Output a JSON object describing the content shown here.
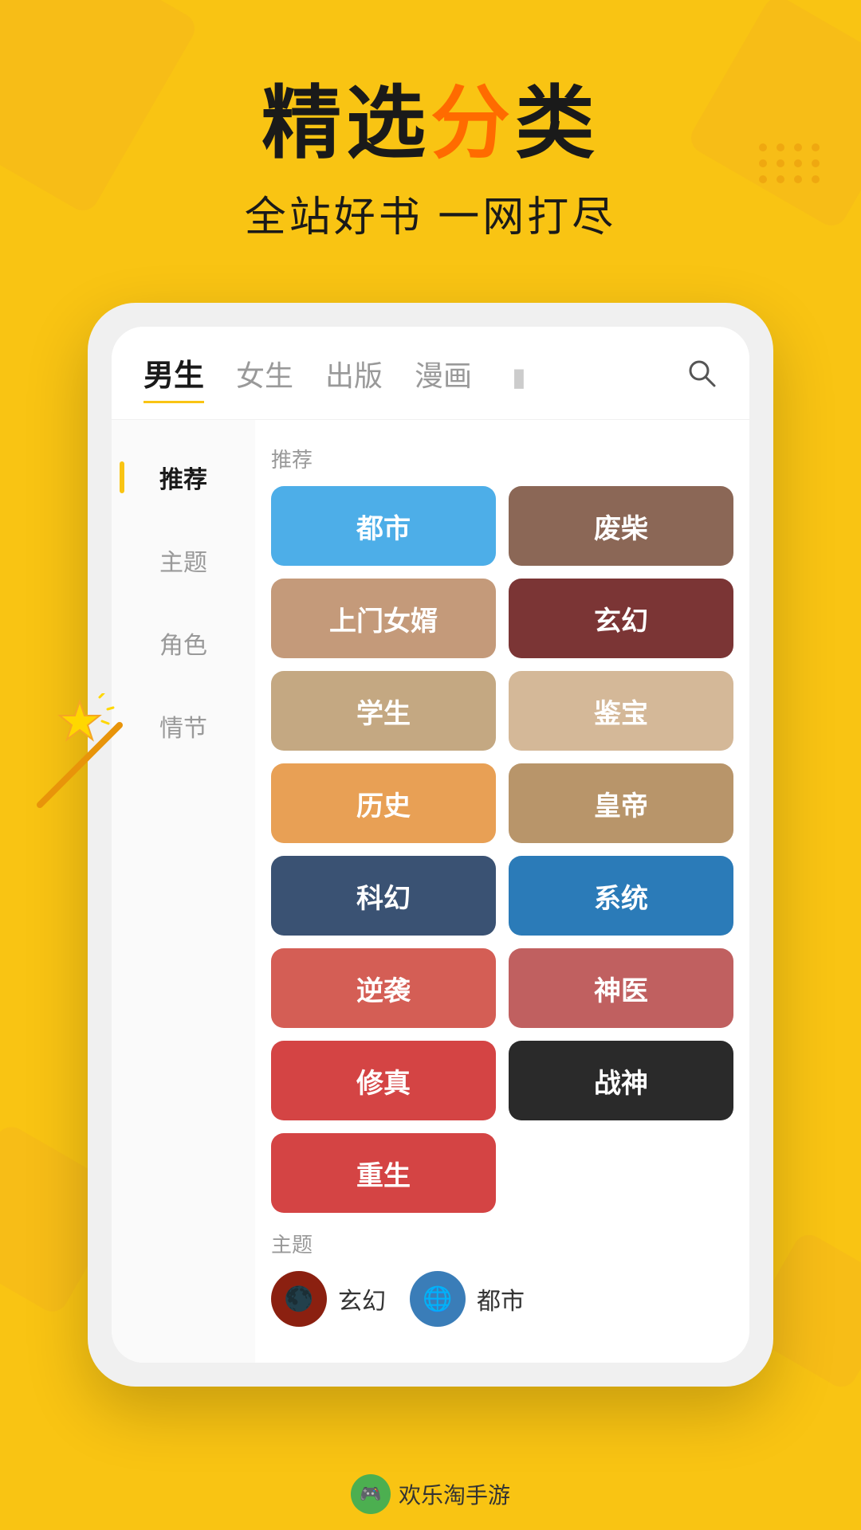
{
  "background_color": "#F9C413",
  "header": {
    "main_title_part1": "精选",
    "main_title_highlight": "分",
    "main_title_part2": "类",
    "sub_title": "全站好书 一网打尽"
  },
  "tabs": [
    {
      "label": "男生",
      "active": true
    },
    {
      "label": "女生",
      "active": false
    },
    {
      "label": "出版",
      "active": false
    },
    {
      "label": "漫画",
      "active": false
    }
  ],
  "sidebar": {
    "items": [
      {
        "label": "推荐",
        "active": true
      },
      {
        "label": "主题",
        "active": false
      },
      {
        "label": "角色",
        "active": false
      },
      {
        "label": "情节",
        "active": false
      }
    ]
  },
  "section_label": "推荐",
  "categories": [
    {
      "label": "都市",
      "class": "cat-dushi"
    },
    {
      "label": "废柴",
      "class": "cat-feizhai"
    },
    {
      "label": "上门女婿",
      "class": "cat-shangmen"
    },
    {
      "label": "玄幻",
      "class": "cat-xuanhuan"
    },
    {
      "label": "学生",
      "class": "cat-xuesheng"
    },
    {
      "label": "鉴宝",
      "class": "cat-jianbao"
    },
    {
      "label": "历史",
      "class": "cat-lishi"
    },
    {
      "label": "皇帝",
      "class": "cat-huangdi"
    },
    {
      "label": "科幻",
      "class": "cat-keji"
    },
    {
      "label": "系统",
      "class": "cat-xitong"
    },
    {
      "label": "逆袭",
      "class": "cat-nixi"
    },
    {
      "label": "神医",
      "class": "cat-shenyi"
    },
    {
      "label": "修真",
      "class": "cat-xiuzhen"
    },
    {
      "label": "战神",
      "class": "cat-zhanshen"
    },
    {
      "label": "重生",
      "class": "cat-chongsheng"
    }
  ],
  "bottom_section_label": "主题",
  "bottom_items": [
    {
      "label": "玄幻",
      "icon_color": "#8B2010"
    },
    {
      "label": "都市",
      "icon_color": "#3A7DB8"
    }
  ],
  "logo": {
    "text": "欢乐淘手游",
    "icon_color": "#4CAF50"
  }
}
